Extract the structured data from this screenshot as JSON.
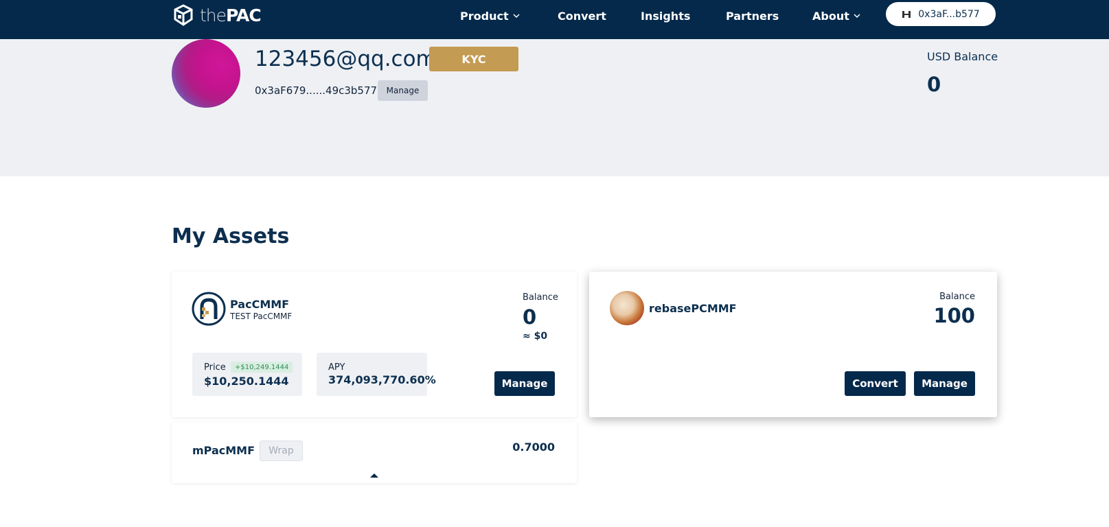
{
  "nav": {
    "logo_the": "the",
    "logo_pac": "PAC",
    "items": [
      {
        "label": "Product",
        "dropdown": true
      },
      {
        "label": "Convert",
        "dropdown": false
      },
      {
        "label": "Insights",
        "dropdown": false
      },
      {
        "label": "Partners",
        "dropdown": false
      },
      {
        "label": "About",
        "dropdown": true
      }
    ],
    "wallet": "0x3aF...b577"
  },
  "profile": {
    "email": "123456@qq.com",
    "kyc_label": "KYC",
    "address": "0x3aF679......49c3b577",
    "manage_label": "Manage",
    "usd_balance_label": "USD Balance",
    "usd_balance_value": "0"
  },
  "assets": {
    "title": "My Assets",
    "paccmmf": {
      "name": "PacCMMF",
      "subtitle": "TEST PacCMMF",
      "balance_label": "Balance",
      "balance": "0",
      "balance_usd": "≈ $0",
      "price_label": "Price",
      "price_delta": "+$10,249.1444",
      "price": "$10,250.1444",
      "apy_label": "APY",
      "apy": "374,093,770.60%",
      "manage_label": "Manage"
    },
    "rebase": {
      "name": "rebasePCMMF",
      "balance_label": "Balance",
      "balance": "100",
      "convert_label": "Convert",
      "manage_label": "Manage"
    },
    "mpacmmf": {
      "name": "mPacMMF",
      "wrap_label": "Wrap",
      "value": "0.7000"
    }
  },
  "colors": {
    "navy": "#05294b",
    "kyc_gold": "#c49b52",
    "profile_bg": "#eef0f4"
  }
}
